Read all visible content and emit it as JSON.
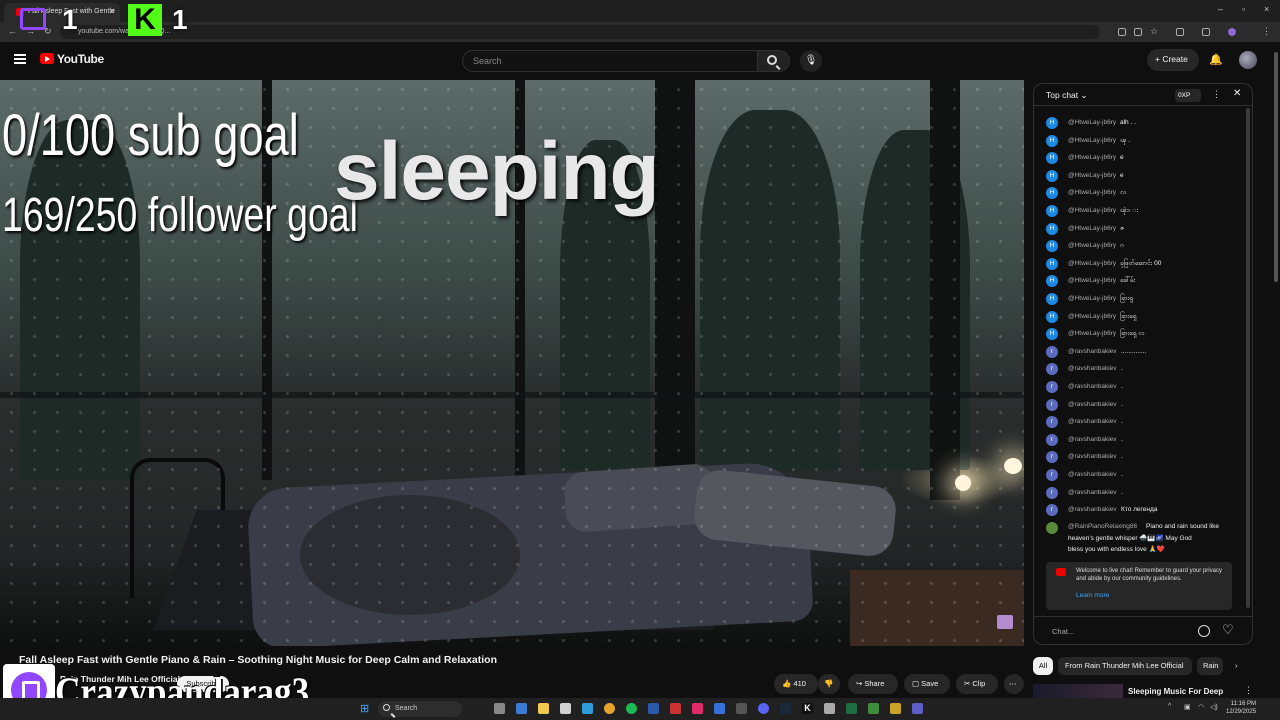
{
  "browser": {
    "tab_title": "Fall Asleep Fast with Gentle",
    "url": "youtube.com/watch?v=QgQ..."
  },
  "overlay": {
    "twitch_count": "1",
    "kick_letter": "K",
    "kick_count": "1",
    "sub_goal": "0/100 sub goal",
    "follower_goal": "169/250 follower goal",
    "stream_word": "sleeping",
    "streamer_name": "Crazypandarag3"
  },
  "youtube": {
    "logo_text": "YouTube",
    "search_placeholder": "Search",
    "create_label": "Create"
  },
  "video": {
    "title": "Fall Asleep Fast with Gentle Piano & Rain – Soothing Night Music for Deep Calm and Relaxation",
    "channel": "Rain Thunder Mih Lee Official",
    "subscribers": "",
    "subscribe_label": "Subscribe",
    "likes": "410",
    "share_label": "Share",
    "save_label": "Save",
    "clip_label": "Clip"
  },
  "chat": {
    "header": "Top chat",
    "xp_label": "0XP",
    "messages": [
      {
        "author": "@HtweLay-jb6ry",
        "text": "alh . .",
        "initial": "H",
        "color": "#1e88e5"
      },
      {
        "author": "@HtweLay-jb6ry",
        "text": "ၾ .",
        "initial": "H",
        "color": "#1e88e5"
      },
      {
        "author": "@HtweLay-jb6ry",
        "text": "e",
        "initial": "H",
        "color": "#1e88e5"
      },
      {
        "author": "@HtweLay-jb6ry",
        "text": "e",
        "initial": "H",
        "color": "#1e88e5"
      },
      {
        "author": "@HtweLay-jb6ry",
        "text": "လ",
        "initial": "H",
        "color": "#1e88e5"
      },
      {
        "author": "@HtweLay-jb6ry",
        "text": "ၾဲ၁ း",
        "initial": "H",
        "color": "#1e88e5"
      },
      {
        "author": "@HtweLay-jb6ry",
        "text": "ဇ",
        "initial": "H",
        "color": "#1e88e5"
      },
      {
        "author": "@HtweLay-jb6ry",
        "text": "ဂ",
        "initial": "H",
        "color": "#1e88e5"
      },
      {
        "author": "@HtweLay-jb6ry",
        "text": "ခုဖြတ်ဆောင်း 00",
        "initial": "H",
        "color": "#1e88e5"
      },
      {
        "author": "@HtweLay-jb6ry",
        "text": "ခေါ်မ်း",
        "initial": "H",
        "color": "#1e88e5"
      },
      {
        "author": "@HtweLay-jb6ry",
        "text": "ခြားရှ",
        "initial": "H",
        "color": "#1e88e5"
      },
      {
        "author": "@HtweLay-jb6ry",
        "text": "ခြားရှေ",
        "initial": "H",
        "color": "#1e88e5"
      },
      {
        "author": "@HtweLay-jb6ry",
        "text": "ခြားရှေ လ",
        "initial": "H",
        "color": "#1e88e5"
      },
      {
        "author": "@ravshanbakiev",
        "text": "..............",
        "initial": "r",
        "color": "#5c6bc0"
      },
      {
        "author": "@ravshanbakiev",
        "text": ".",
        "initial": "r",
        "color": "#5c6bc0"
      },
      {
        "author": "@ravshanbakiev",
        "text": ".",
        "initial": "r",
        "color": "#5c6bc0"
      },
      {
        "author": "@ravshanbakiev",
        "text": ".",
        "initial": "r",
        "color": "#5c6bc0"
      },
      {
        "author": "@ravshanbakiev",
        "text": ".",
        "initial": "r",
        "color": "#5c6bc0"
      },
      {
        "author": "@ravshanbakiev",
        "text": ".",
        "initial": "r",
        "color": "#5c6bc0"
      },
      {
        "author": "@ravshanbakiev",
        "text": ".",
        "initial": "r",
        "color": "#5c6bc0"
      },
      {
        "author": "@ravshanbakiev",
        "text": ".",
        "initial": "r",
        "color": "#5c6bc0"
      },
      {
        "author": "@ravshanbakiev",
        "text": ".",
        "initial": "r",
        "color": "#5c6bc0"
      },
      {
        "author": "@ravshanbakiev",
        "text": "Кто легенда",
        "initial": "r",
        "color": "#5c6bc0"
      }
    ],
    "long_message": {
      "author": "@RainPianoRelaxing86",
      "line1": "Piano and rain sound like",
      "line2": "heaven's gentle whisper 🌧️🎹🌌 May God",
      "line3": "bless you with endless love 🙏❤️"
    },
    "welcome_text": "Welcome to live chat! Remember to guard your privacy and abide by our community guidelines.",
    "learn_more": "Learn more",
    "input_placeholder": "Chat..."
  },
  "chips": {
    "all": "All",
    "from_channel": "From Rain Thunder Mih Lee Official",
    "rain": "Rain"
  },
  "recommended": {
    "title": "Sleeping Music For Deep"
  },
  "taskbar": {
    "search": "Search",
    "time": "11:16 PM",
    "date": "12/29/2025"
  },
  "colors": {
    "bg": "#0f0f0f",
    "yt_red": "#ff0000",
    "kick_green": "#53fc18",
    "twitch_purple": "#9146ff",
    "link_blue": "#3ea6ff"
  }
}
